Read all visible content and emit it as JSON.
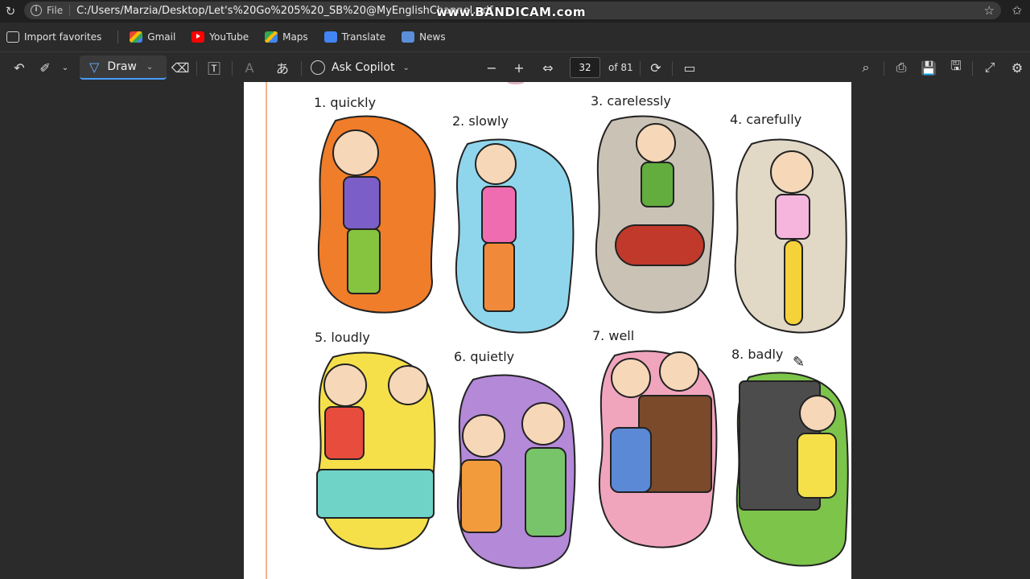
{
  "address_bar": {
    "file_label": "File",
    "url": "C:/Users/Marzia/Desktop/Let's%20Go%205%20_SB%20@MyEnglishChannel.pdf",
    "watermark": "www.BANDICAM.com"
  },
  "favorites": [
    {
      "label": "Import favorites",
      "icon": "import-icon"
    },
    {
      "label": "Gmail",
      "icon": "gmail-icon"
    },
    {
      "label": "YouTube",
      "icon": "youtube-icon"
    },
    {
      "label": "Maps",
      "icon": "maps-icon"
    },
    {
      "label": "Translate",
      "icon": "translate-icon"
    },
    {
      "label": "News",
      "icon": "news-icon"
    }
  ],
  "toolbar": {
    "draw_label": "Draw",
    "copilot_label": "Ask Copilot",
    "page_number": "32",
    "page_total": "of 81"
  },
  "pdf_page": {
    "items": [
      {
        "label": "1. quickly",
        "colors": [
          "#f07d2a",
          "#7b5ec7",
          "#86c440"
        ]
      },
      {
        "label": "2. slowly",
        "colors": [
          "#8fd6ec",
          "#f06cb0",
          "#f08a3a"
        ]
      },
      {
        "label": "3. carelessly",
        "colors": [
          "#c9c2b5",
          "#62ad3e",
          "#c0392b"
        ]
      },
      {
        "label": "4. carefully",
        "colors": [
          "#e2d8c6",
          "#f5b5dc",
          "#f5d23a"
        ]
      },
      {
        "label": "5. loudly",
        "colors": [
          "#f5e04a",
          "#e74c3c",
          "#6fd3c7"
        ]
      },
      {
        "label": "6. quietly",
        "colors": [
          "#b489d8",
          "#78c46a",
          "#f29b3c"
        ]
      },
      {
        "label": "7. well",
        "colors": [
          "#f0a5bd",
          "#7a4a2a",
          "#5b89d6"
        ]
      },
      {
        "label": "8. badly",
        "colors": [
          "#7cc44a",
          "#4c4c4c",
          "#f5e04a"
        ]
      }
    ]
  }
}
